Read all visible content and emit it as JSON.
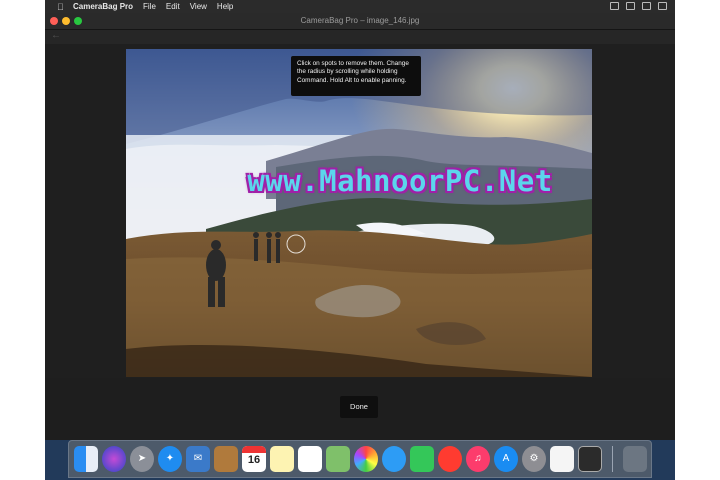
{
  "menubar": {
    "app_name": "CameraBag Pro",
    "items": [
      "File",
      "Edit",
      "View",
      "Help"
    ]
  },
  "window": {
    "title": "CameraBag Pro – image_146.jpg"
  },
  "tooltip": {
    "text": "Click on spots to remove them. Change the radius by scrolling while holding Command. Hold Alt to enable panning."
  },
  "watermark": {
    "text": "www.MahnoorPC.Net"
  },
  "done_label": "Done",
  "dock": {
    "calendar_day": "16",
    "icons": [
      "finder-icon",
      "siri-icon",
      "launchpad-icon",
      "safari-icon",
      "mail-icon",
      "contacts-icon",
      "calendar-icon",
      "notes-icon",
      "reminders-icon",
      "maps-icon",
      "photos-icon",
      "messages-icon",
      "facetime-icon",
      "news-icon",
      "music-icon",
      "app-store-icon",
      "system-preferences-icon",
      "textedit-icon",
      "camerabag-icon",
      "trash-icon"
    ]
  },
  "colors": {
    "accent_red": "#ff5f57",
    "accent_yellow": "#febc2e",
    "accent_green": "#28c840",
    "watermark_fill": "#5bd6ec",
    "watermark_stroke": "#a020a8"
  }
}
